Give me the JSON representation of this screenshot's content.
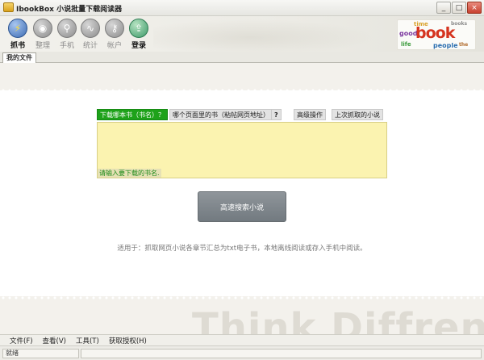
{
  "window": {
    "title": "IbookBox 小说批量下载阅读器",
    "controls": [
      "_",
      "□",
      "×"
    ]
  },
  "toolbar": {
    "items": [
      {
        "label": "抓书",
        "icon": "lightning-icon",
        "active": true,
        "bold": true
      },
      {
        "label": "整理",
        "icon": "disc-icon",
        "active": false,
        "bold": false
      },
      {
        "label": "手机",
        "icon": "search-icon",
        "active": false,
        "bold": false
      },
      {
        "label": "统计",
        "icon": "wave-icon",
        "active": false,
        "bold": false
      },
      {
        "label": "帐户",
        "icon": "key-icon",
        "active": false,
        "bold": false
      },
      {
        "label": "登录",
        "icon": "cloud-upload-icon",
        "active": false,
        "bold": true
      }
    ]
  },
  "logo": {
    "word": "book",
    "cloud": [
      "time",
      "good",
      "people",
      "life",
      "books",
      "the"
    ]
  },
  "tabs": [
    {
      "label": "我的文件",
      "active": true
    }
  ],
  "search": {
    "segments": [
      "下载哪本书（书名）？",
      "哪个页面里的书（粘帖网页地址）",
      "?",
      "高级操作",
      "上次抓取的小说"
    ],
    "placeholder": "请输入要下载的书名.",
    "button_label": "高速搜索小说",
    "hint": "适用于：抓取网页小说各章节汇总为txt电子书，本地离线阅读或存入手机中阅读。"
  },
  "watermark": "Think Diffrent",
  "menu": [
    "文件(F)",
    "查看(V)",
    "工具(T)",
    "获取授权(H)"
  ],
  "status": {
    "text": "就绪"
  },
  "colors": {
    "accent_green": "#1ea21a",
    "input_bg": "#fbf3b0",
    "button_gray": "#7f868b"
  }
}
